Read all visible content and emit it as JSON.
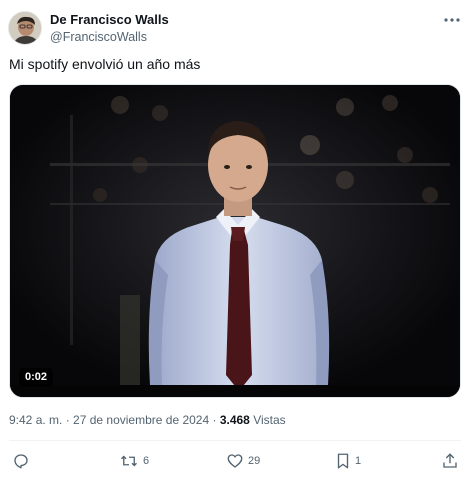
{
  "author": {
    "display_name": "De Francisco Walls",
    "handle": "@FranciscoWalls"
  },
  "tweet": {
    "text": "Mi spotify envolvió un año más"
  },
  "media": {
    "timestamp": "0:02"
  },
  "meta": {
    "time": "9:42 a. m.",
    "sep1": " · ",
    "date": "27 de noviembre de 2024",
    "sep2": " · ",
    "views_count": "3.468",
    "views_label": "Vistas"
  },
  "actions": {
    "reply_count": "",
    "retweet_count": "6",
    "like_count": "29",
    "bookmark_count": "1"
  },
  "icons": [
    "more-icon",
    "reply-icon",
    "retweet-icon",
    "like-icon",
    "bookmark-icon",
    "share-icon"
  ],
  "colors": {
    "text_primary": "#0f1419",
    "text_secondary": "#536471",
    "divider": "#eff3f4"
  }
}
